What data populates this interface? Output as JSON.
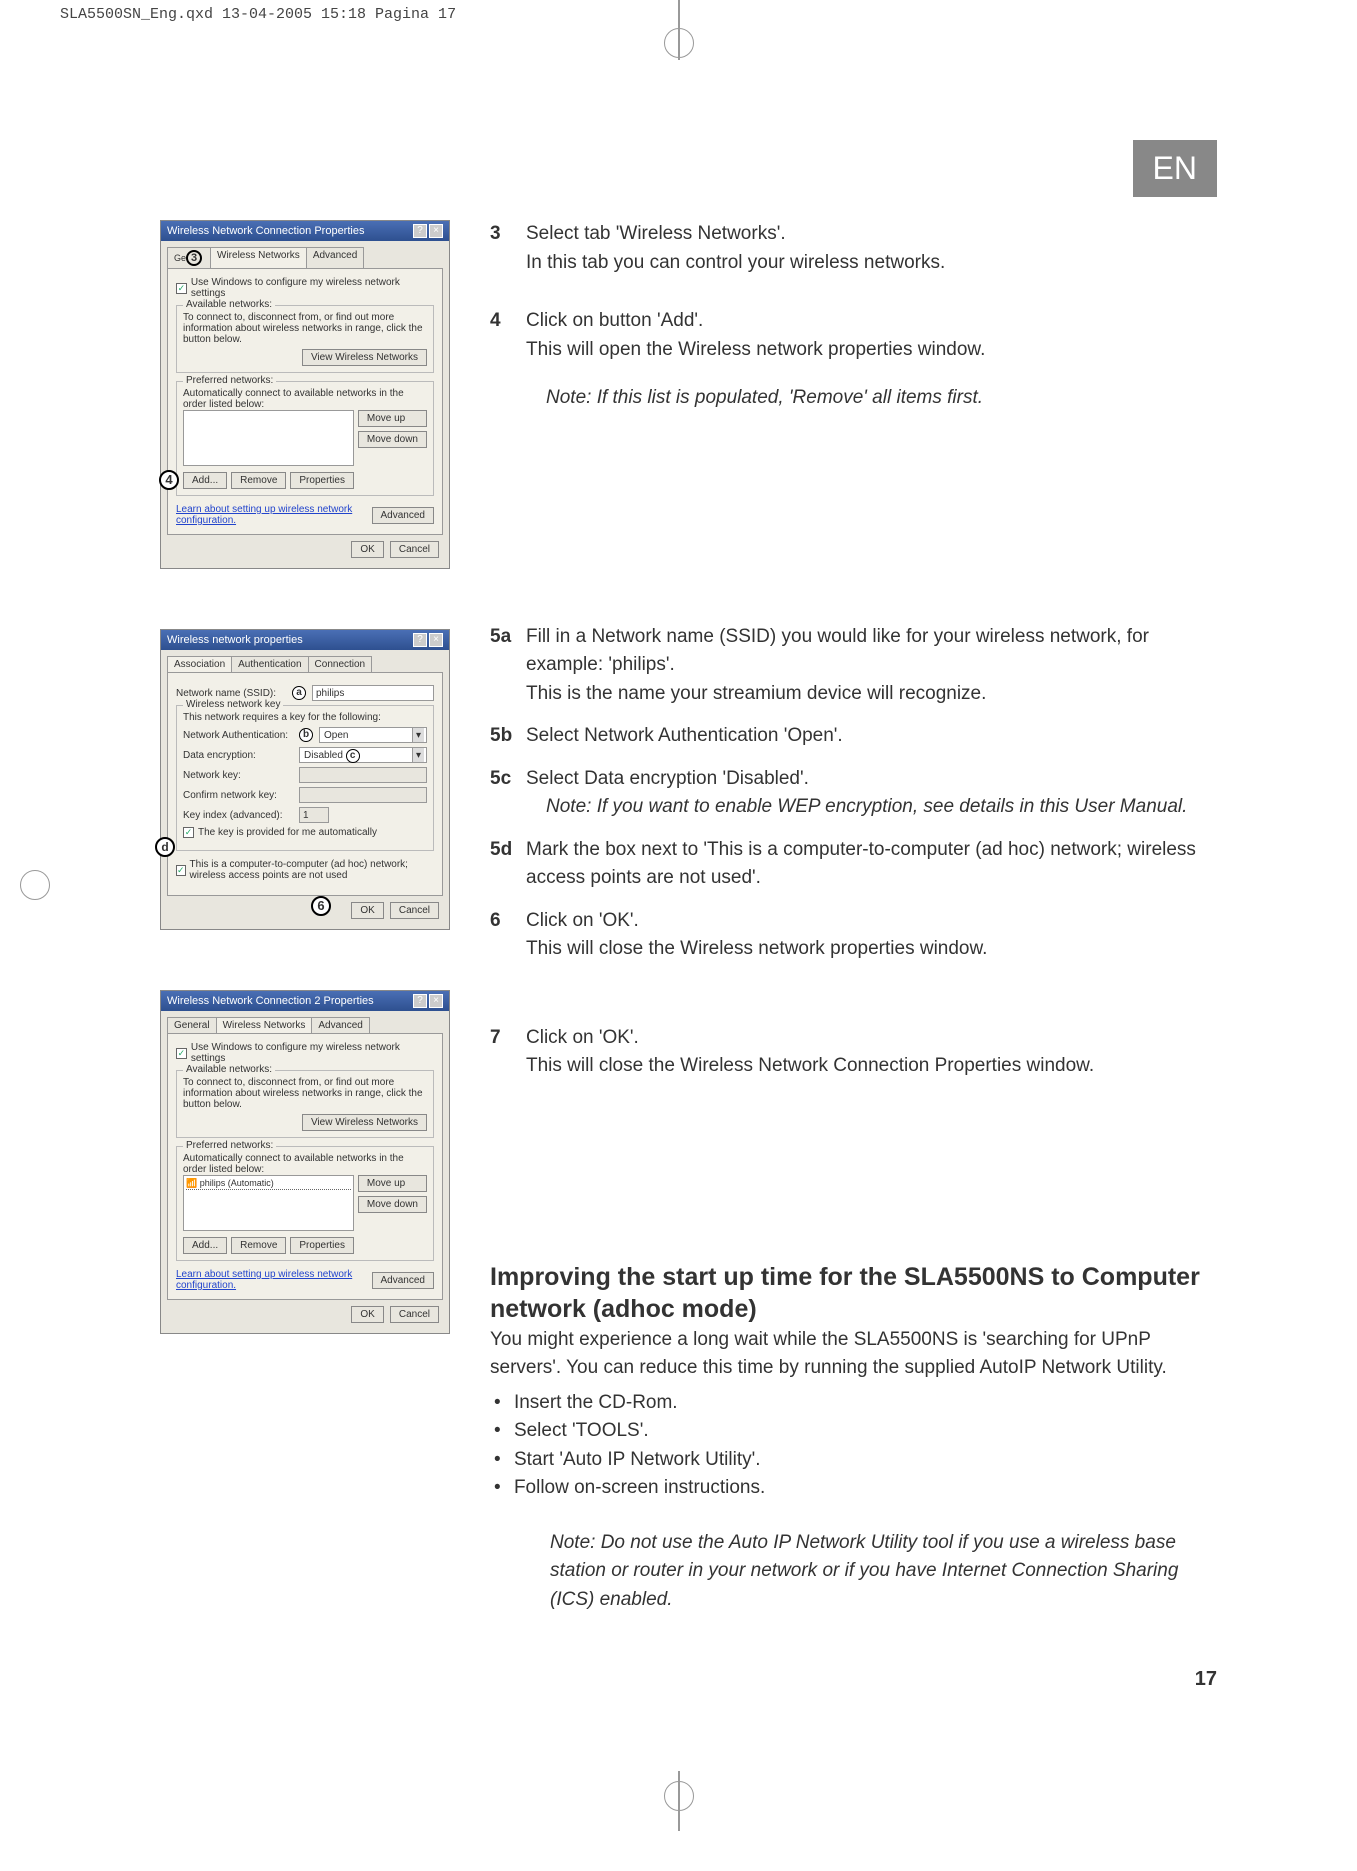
{
  "header": "SLA5500SN_Eng.qxd  13-04-2005  15:18  Pagina 17",
  "lang_badge": "EN",
  "page_number": "17",
  "dialog1": {
    "title": "Wireless Network Connection Properties",
    "tabs": [
      "General",
      "Wireless Networks",
      "Advanced"
    ],
    "tab_badge_3": "3",
    "use_windows": "Use Windows to configure my wireless network settings",
    "available_title": "Available networks:",
    "available_desc": "To connect to, disconnect from, or find out more information about wireless networks in range, click the button below.",
    "view_btn": "View Wireless Networks",
    "preferred_title": "Preferred networks:",
    "preferred_desc": "Automatically connect to available networks in the order listed below:",
    "move_up": "Move up",
    "move_down": "Move down",
    "add": "Add...",
    "remove": "Remove",
    "properties": "Properties",
    "callout_4": "4",
    "learn": "Learn about setting up wireless network configuration.",
    "advanced": "Advanced",
    "ok": "OK",
    "cancel": "Cancel"
  },
  "dialog2": {
    "title": "Wireless network properties",
    "tabs": [
      "Association",
      "Authentication",
      "Connection"
    ],
    "ssid_label": "Network name (SSID):",
    "ssid_value": "philips",
    "callout_a": "a",
    "key_group": "Wireless network key",
    "key_desc": "This network requires a key for the following:",
    "auth_label": "Network Authentication:",
    "auth_value": "Open",
    "callout_b": "b",
    "enc_label": "Data encryption:",
    "enc_value": "Disabled",
    "callout_c": "c",
    "netkey_label": "Network key:",
    "confirm_label": "Confirm network key:",
    "keyindex_label": "Key index (advanced):",
    "keyindex_value": "1",
    "auto_key": "The key is provided for me automatically",
    "callout_d": "d",
    "adhoc": "This is a computer-to-computer (ad hoc) network; wireless access points are not used",
    "callout_6": "6",
    "ok": "OK",
    "cancel": "Cancel"
  },
  "dialog3": {
    "title": "Wireless Network Connection 2 Properties",
    "tabs": [
      "General",
      "Wireless Networks",
      "Advanced"
    ],
    "use_windows": "Use Windows to configure my wireless network settings",
    "available_title": "Available networks:",
    "available_desc": "To connect to, disconnect from, or find out more information about wireless networks in range, click the button below.",
    "view_btn": "View Wireless Networks",
    "preferred_title": "Preferred networks:",
    "preferred_desc": "Automatically connect to available networks in the order listed below:",
    "pref_item": "philips (Automatic)",
    "move_up": "Move up",
    "move_down": "Move down",
    "add": "Add...",
    "remove": "Remove",
    "properties": "Properties",
    "learn": "Learn about setting up wireless network configuration.",
    "advanced": "Advanced",
    "ok": "OK",
    "cancel": "Cancel"
  },
  "steps": {
    "s3": {
      "num": "3",
      "line1": "Select tab 'Wireless Networks'.",
      "line2": "In this tab you can control your wireless networks."
    },
    "s4": {
      "num": "4",
      "line1": "Click on button 'Add'.",
      "line2": "This will open the Wireless network properties window.",
      "note": "Note: If this list is populated, 'Remove' all items first."
    },
    "s5a": {
      "num": "5a",
      "line1": "Fill in a Network name (SSID) you would like for your wireless network, for example: 'philips'.",
      "line2": "This is the name your streamium device will recognize."
    },
    "s5b": {
      "num": "5b",
      "line1": "Select Network Authentication 'Open'."
    },
    "s5c": {
      "num": "5c",
      "line1": "Select Data encryption 'Disabled'.",
      "note": "Note: If you want to enable WEP encryption, see details in this User Manual."
    },
    "s5d": {
      "num": "5d",
      "line1": "Mark the box next to 'This is a computer-to-computer (ad hoc) network; wireless access points are not used'."
    },
    "s6": {
      "num": "6",
      "line1": "Click on 'OK'.",
      "line2": "This will close the Wireless network properties window."
    },
    "s7": {
      "num": "7",
      "line1": "Click on 'OK'.",
      "line2": "This will close the Wireless Network Connection Properties window."
    }
  },
  "improve": {
    "heading": "Improving the start up time for the SLA5500NS to Computer network (adhoc mode)",
    "body": "You might experience a long wait while the SLA5500NS is 'searching for UPnP servers'. You can reduce this time by running the supplied AutoIP Network Utility.",
    "bullets": [
      "Insert the CD-Rom.",
      "Select 'TOOLS'.",
      "Start 'Auto IP Network Utility'.",
      "Follow on-screen instructions."
    ],
    "note": "Note: Do not use the Auto IP Network Utility tool if you use a wireless base station or router in your network or if you have Internet Connection Sharing (ICS) enabled."
  }
}
